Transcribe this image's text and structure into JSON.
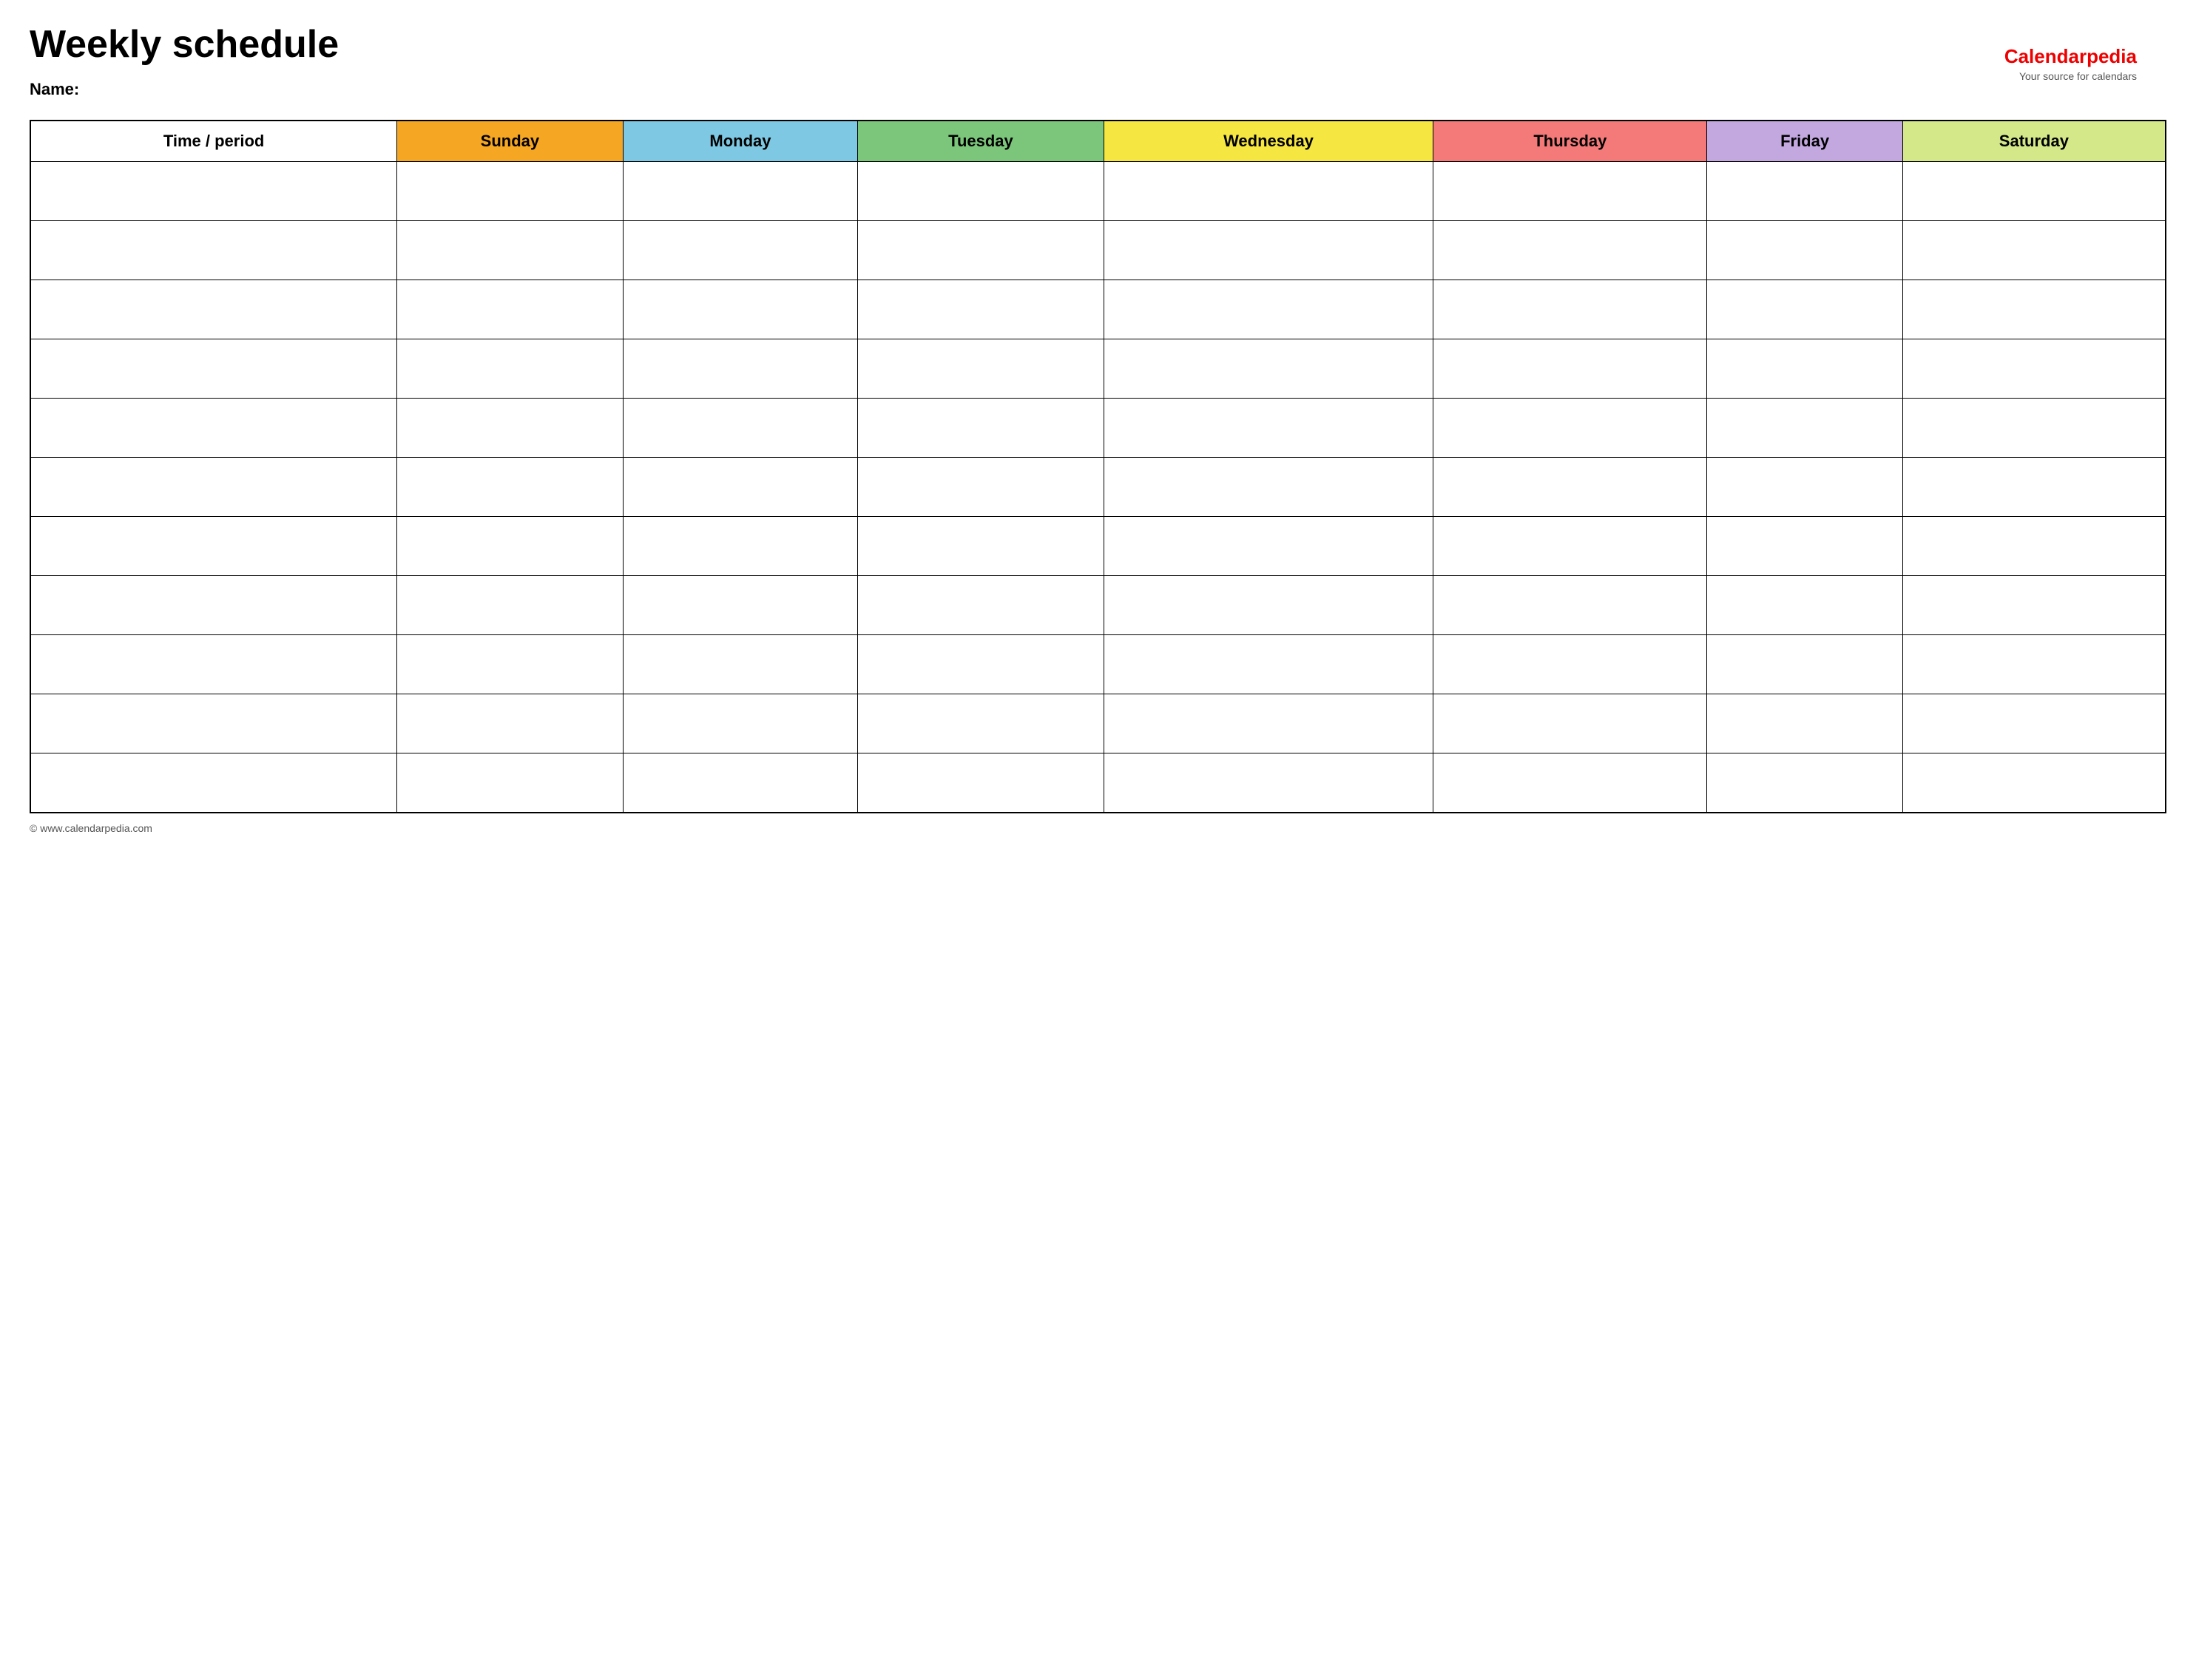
{
  "page": {
    "title": "Weekly schedule",
    "name_label": "Name:",
    "footer_url": "© www.calendarpedia.com"
  },
  "logo": {
    "brand_part1": "Calendar",
    "brand_part2": "pedia",
    "tagline": "Your source for calendars"
  },
  "table": {
    "headers": [
      {
        "id": "time",
        "label": "Time / period",
        "class": "th-time"
      },
      {
        "id": "sunday",
        "label": "Sunday",
        "class": "th-sunday"
      },
      {
        "id": "monday",
        "label": "Monday",
        "class": "th-monday"
      },
      {
        "id": "tuesday",
        "label": "Tuesday",
        "class": "th-tuesday"
      },
      {
        "id": "wednesday",
        "label": "Wednesday",
        "class": "th-wednesday"
      },
      {
        "id": "thursday",
        "label": "Thursday",
        "class": "th-thursday"
      },
      {
        "id": "friday",
        "label": "Friday",
        "class": "th-friday"
      },
      {
        "id": "saturday",
        "label": "Saturday",
        "class": "th-saturday"
      }
    ],
    "row_count": 11
  }
}
